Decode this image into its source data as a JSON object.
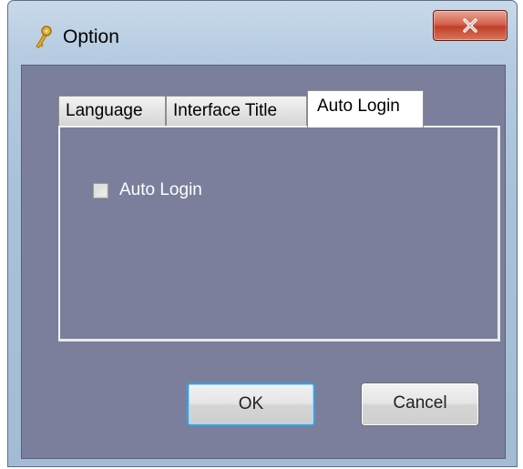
{
  "window": {
    "title": "Option",
    "close_label": "X"
  },
  "tabs": [
    {
      "label": "Language",
      "active": false
    },
    {
      "label": "Interface Title",
      "active": false
    },
    {
      "label": "Auto Login",
      "active": true
    }
  ],
  "auto_login_panel": {
    "checkbox_label": "Auto Login",
    "checked": false
  },
  "buttons": {
    "ok_label": "OK",
    "cancel_label": "Cancel"
  },
  "icons": {
    "app": "key-icon",
    "close": "close-icon"
  },
  "colors": {
    "client_background": "#7b7f9c",
    "close_button": "#c8503a",
    "focus_border": "#3e9fd8"
  }
}
